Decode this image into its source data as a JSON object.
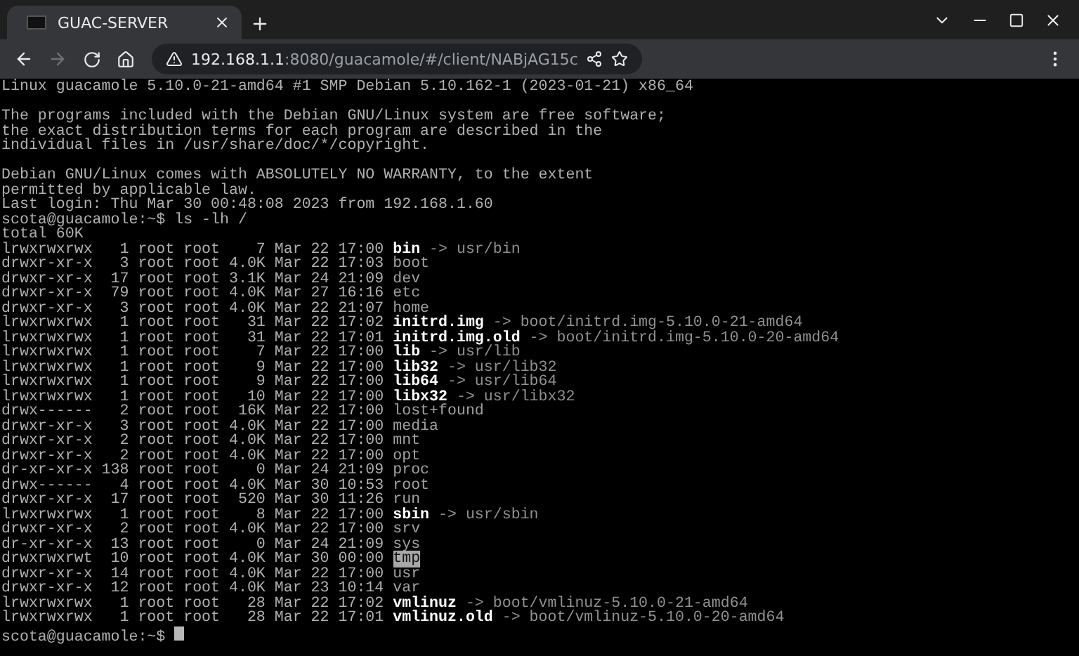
{
  "tab": {
    "title": "GUAC-SERVER",
    "selected": true
  },
  "nav": {
    "back_disabled": false,
    "forward_disabled": true
  },
  "url": {
    "host": "192.168.1.1",
    "path": ":8080/guacamole/#/client/NABjAG15c"
  },
  "terminal": {
    "lines": [
      {
        "kind": "text",
        "text": "Linux guacamole 5.10.0-21-amd64 #1 SMP Debian 5.10.162-1 (2023-01-21) x86_64"
      },
      {
        "kind": "blank"
      },
      {
        "kind": "text",
        "text": "The programs included with the Debian GNU/Linux system are free software;"
      },
      {
        "kind": "text",
        "text": "the exact distribution terms for each program are described in the"
      },
      {
        "kind": "text",
        "text": "individual files in /usr/share/doc/*/copyright."
      },
      {
        "kind": "blank"
      },
      {
        "kind": "text",
        "text": "Debian GNU/Linux comes with ABSOLUTELY NO WARRANTY, to the extent"
      },
      {
        "kind": "text",
        "text": "permitted by applicable law."
      },
      {
        "kind": "text",
        "text": "Last login: Thu Mar 30 00:48:08 2023 from 192.168.1.60"
      },
      {
        "kind": "text",
        "text": "scota@guacamole:~$ ls -lh /"
      },
      {
        "kind": "text",
        "text": "total 60K"
      },
      {
        "kind": "link",
        "meta": "lrwxrwxrwx   1 root root    7 Mar 22 17:00",
        "name": "bin",
        "target": "-> usr/bin"
      },
      {
        "kind": "dir",
        "meta": "drwxr-xr-x   3 root root 4.0K Mar 22 17:03",
        "name": "boot"
      },
      {
        "kind": "dir",
        "meta": "drwxr-xr-x  17 root root 3.1K Mar 24 21:09",
        "name": "dev"
      },
      {
        "kind": "dir",
        "meta": "drwxr-xr-x  79 root root 4.0K Mar 27 16:16",
        "name": "etc"
      },
      {
        "kind": "dir",
        "meta": "drwxr-xr-x   3 root root 4.0K Mar 22 21:07",
        "name": "home"
      },
      {
        "kind": "link",
        "meta": "lrwxrwxrwx   1 root root   31 Mar 22 17:02",
        "name": "initrd.img",
        "target": "-> boot/initrd.img-5.10.0-21-amd64"
      },
      {
        "kind": "link",
        "meta": "lrwxrwxrwx   1 root root   31 Mar 22 17:01",
        "name": "initrd.img.old",
        "target": "-> boot/initrd.img-5.10.0-20-amd64"
      },
      {
        "kind": "link",
        "meta": "lrwxrwxrwx   1 root root    7 Mar 22 17:00",
        "name": "lib",
        "target": "-> usr/lib"
      },
      {
        "kind": "link",
        "meta": "lrwxrwxrwx   1 root root    9 Mar 22 17:00",
        "name": "lib32",
        "target": "-> usr/lib32"
      },
      {
        "kind": "link",
        "meta": "lrwxrwxrwx   1 root root    9 Mar 22 17:00",
        "name": "lib64",
        "target": "-> usr/lib64"
      },
      {
        "kind": "link",
        "meta": "lrwxrwxrwx   1 root root   10 Mar 22 17:00",
        "name": "libx32",
        "target": "-> usr/libx32"
      },
      {
        "kind": "dir",
        "meta": "drwx------   2 root root  16K Mar 22 17:00",
        "name": "lost+found"
      },
      {
        "kind": "dir",
        "meta": "drwxr-xr-x   3 root root 4.0K Mar 22 17:00",
        "name": "media"
      },
      {
        "kind": "dir",
        "meta": "drwxr-xr-x   2 root root 4.0K Mar 22 17:00",
        "name": "mnt"
      },
      {
        "kind": "dir",
        "meta": "drwxr-xr-x   2 root root 4.0K Mar 22 17:00",
        "name": "opt"
      },
      {
        "kind": "dir",
        "meta": "dr-xr-xr-x 138 root root    0 Mar 24 21:09",
        "name": "proc"
      },
      {
        "kind": "dir",
        "meta": "drwx------   4 root root 4.0K Mar 30 10:53",
        "name": "root"
      },
      {
        "kind": "dir",
        "meta": "drwxr-xr-x  17 root root  520 Mar 30 11:26",
        "name": "run"
      },
      {
        "kind": "link",
        "meta": "lrwxrwxrwx   1 root root    8 Mar 22 17:00",
        "name": "sbin",
        "target": "-> usr/sbin"
      },
      {
        "kind": "dir",
        "meta": "drwxr-xr-x   2 root root 4.0K Mar 22 17:00",
        "name": "srv"
      },
      {
        "kind": "dir",
        "meta": "dr-xr-xr-x  13 root root    0 Mar 24 21:09",
        "name": "sys"
      },
      {
        "kind": "sticky",
        "meta": "drwxrwxrwt  10 root root 4.0K Mar 30 00:00",
        "name": "tmp"
      },
      {
        "kind": "dir",
        "meta": "drwxr-xr-x  14 root root 4.0K Mar 22 17:00",
        "name": "usr"
      },
      {
        "kind": "dir",
        "meta": "drwxr-xr-x  12 root root 4.0K Mar 23 10:14",
        "name": "var"
      },
      {
        "kind": "link",
        "meta": "lrwxrwxrwx   1 root root   28 Mar 22 17:02",
        "name": "vmlinuz",
        "target": "-> boot/vmlinuz-5.10.0-21-amd64"
      },
      {
        "kind": "link",
        "meta": "lrwxrwxrwx   1 root root   28 Mar 22 17:01",
        "name": "vmlinuz.old",
        "target": "-> boot/vmlinuz-5.10.0-20-amd64"
      },
      {
        "kind": "prompt",
        "text": "scota@guacamole:~$"
      }
    ]
  }
}
